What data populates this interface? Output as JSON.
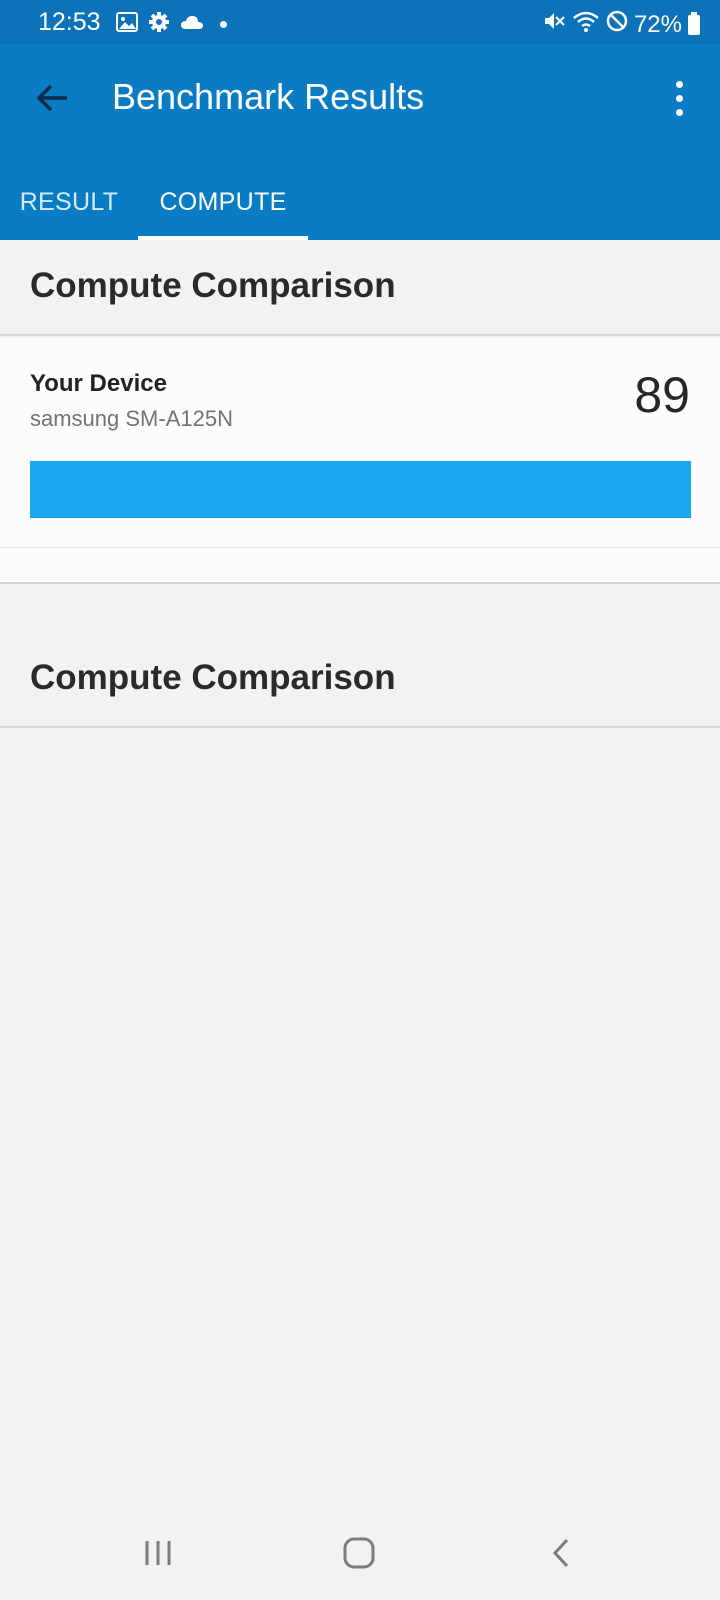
{
  "status_bar": {
    "time": "12:53",
    "battery": "72%",
    "left_icons": [
      "image-icon",
      "settings-gear-icon",
      "cloud-icon",
      "dot-icon"
    ],
    "right_icons": [
      "mute-icon",
      "wifi-icon",
      "block-icon",
      "battery-icon"
    ]
  },
  "app_bar": {
    "title": "Benchmark Results",
    "back_icon": "arrow-left-icon",
    "menu_icon": "more-vert-icon",
    "background": "#0a7cc4"
  },
  "tabs": [
    {
      "label": "RESULT",
      "selected": false
    },
    {
      "label": "COMPUTE",
      "selected": true
    }
  ],
  "sections": [
    {
      "title": "Compute Comparison",
      "devices": [
        {
          "label": "Your Device",
          "model": "samsung SM-A125N",
          "score": "89",
          "bar_fraction": 1.0,
          "bar_color": "#1aa8f0"
        }
      ]
    },
    {
      "title": "Compute Comparison",
      "devices": []
    }
  ],
  "nav_bar": {
    "buttons": [
      "recents-icon",
      "home-icon",
      "back-icon"
    ]
  }
}
